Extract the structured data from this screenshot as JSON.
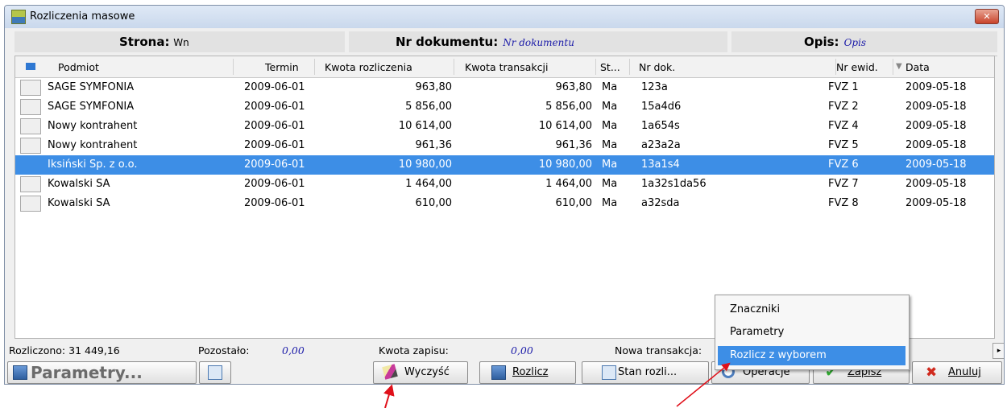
{
  "window": {
    "title": "Rozliczenia masowe",
    "close_glyph": "✕"
  },
  "infobar": {
    "strona_label": "Strona:",
    "strona_value": "Wn",
    "nr_dok_label": "Nr dokumentu:",
    "nr_dok_value": "Nr dokumentu",
    "opis_label": "Opis:",
    "opis_value": "Opis"
  },
  "columns": [
    "Podmiot",
    "Termin",
    "Kwota rozliczenia",
    "Kwota transakcji",
    "St...",
    "Nr dok.",
    "Nr ewid.",
    "Data"
  ],
  "sort_indicator": "▼",
  "rows": [
    {
      "podmiot": "SAGE SYMFONIA",
      "termin": "2009-06-01",
      "kwota_rozl": "963,80",
      "kwota_trans": "963,80",
      "st": "Ma",
      "nr_dok": "123a",
      "nr_ewid": "FVZ 1",
      "data": "2009-05-18"
    },
    {
      "podmiot": "SAGE SYMFONIA",
      "termin": "2009-06-01",
      "kwota_rozl": "5 856,00",
      "kwota_trans": "5 856,00",
      "st": "Ma",
      "nr_dok": "15a4d6",
      "nr_ewid": "FVZ 2",
      "data": "2009-05-18"
    },
    {
      "podmiot": "Nowy kontrahent",
      "termin": "2009-06-01",
      "kwota_rozl": "10 614,00",
      "kwota_trans": "10 614,00",
      "st": "Ma",
      "nr_dok": "1a654s",
      "nr_ewid": "FVZ 4",
      "data": "2009-05-18"
    },
    {
      "podmiot": "Nowy kontrahent",
      "termin": "2009-06-01",
      "kwota_rozl": "961,36",
      "kwota_trans": "961,36",
      "st": "Ma",
      "nr_dok": "a23a2a",
      "nr_ewid": "FVZ 5",
      "data": "2009-05-18"
    },
    {
      "podmiot": "Iksiński Sp. z o.o.",
      "termin": "2009-06-01",
      "kwota_rozl": "10 980,00",
      "kwota_trans": "10 980,00",
      "st": "Ma",
      "nr_dok": "13a1s4",
      "nr_ewid": "FVZ 6",
      "data": "2009-05-18"
    },
    {
      "podmiot": "Kowalski SA",
      "termin": "2009-06-01",
      "kwota_rozl": "1 464,00",
      "kwota_trans": "1 464,00",
      "st": "Ma",
      "nr_dok": "1a32s1da56",
      "nr_ewid": "FVZ 7",
      "data": "2009-05-18"
    },
    {
      "podmiot": "Kowalski SA",
      "termin": "2009-06-01",
      "kwota_rozl": "610,00",
      "kwota_trans": "610,00",
      "st": "Ma",
      "nr_dok": "a32sda",
      "nr_ewid": "FVZ 8",
      "data": "2009-05-18"
    }
  ],
  "selected_row": 4,
  "status": {
    "rozliczono": "Rozliczono: 31 449,16",
    "pozostalo_label": "Pozostało:",
    "pozostalo_value": "0,00",
    "kwota_zapisu_label": "Kwota zapisu:",
    "kwota_zapisu_value": "0,00",
    "nowa_transakcja_label": "Nowa transakcja:",
    "arrow": "▸"
  },
  "toolbar": {
    "parametry": "Parametry...",
    "wyczysc": "Wyczyść",
    "rozlicz": "Rozlicz",
    "stan": "Stan rozli...",
    "operacje": "Operacje",
    "zapisz": "Zapisz",
    "anuluj": "Anuluj",
    "check_glyph": "✔",
    "x_glyph": "✖"
  },
  "menu": {
    "items": [
      "Znaczniki",
      "Parametry",
      "Rozlicz z wyborem"
    ],
    "highlighted": 2
  },
  "colors": {
    "selection": "#3d8ee6",
    "italic_value": "#1a1aa8",
    "annotation_arrow": "#e0101a"
  }
}
